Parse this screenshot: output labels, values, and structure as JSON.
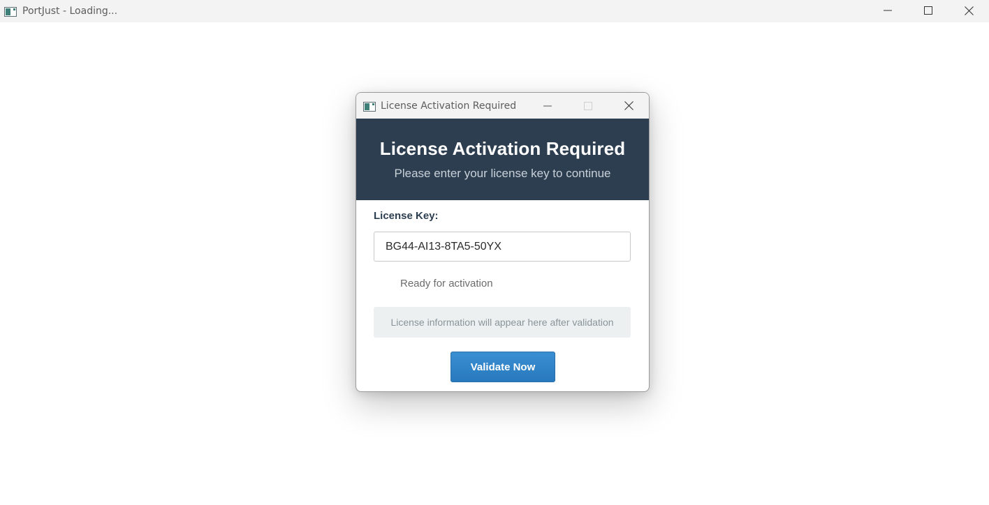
{
  "main_window": {
    "title": "PortJust - Loading...",
    "icon": "app-window-icon",
    "controls": [
      "minimize-icon",
      "maximize-icon",
      "close-icon"
    ]
  },
  "dialog": {
    "window_title": "License Activation Required",
    "icon": "app-window-icon",
    "controls": [
      "minimize-icon",
      "maximize-icon",
      "close-icon"
    ],
    "header": {
      "title": "License Activation Required",
      "subtitle": "Please enter your license key to continue"
    },
    "form": {
      "key_label": "License Key:",
      "key_value": "BG44-AI13-8TA5-50YX",
      "status": "Ready for activation",
      "info_placeholder": "License information will appear here after validation",
      "validate_label": "Validate Now"
    }
  },
  "colors": {
    "header_bg": "#2c3e50",
    "button_bg": "#3182c7",
    "info_bg": "#ecf0f1",
    "titlebar_bg": "#f3f3f3"
  }
}
